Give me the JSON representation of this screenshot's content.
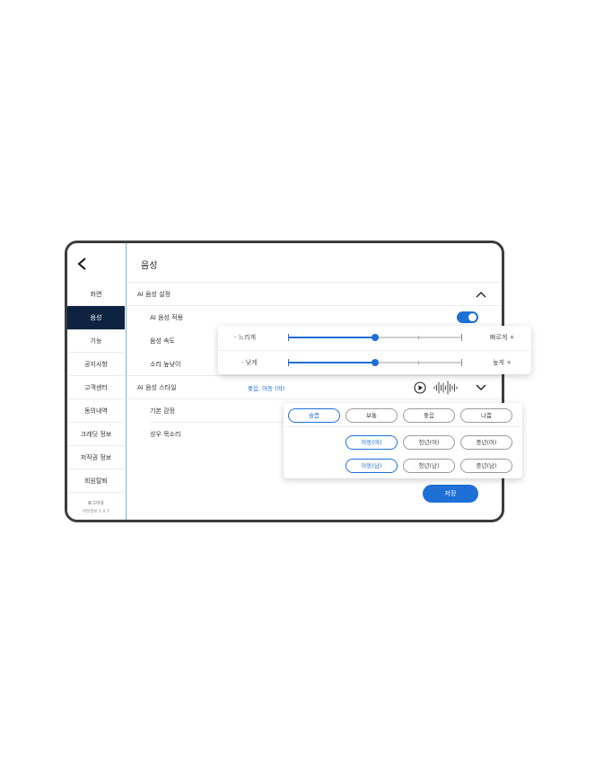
{
  "nav": {
    "items": [
      {
        "label": "화면"
      },
      {
        "label": "음성"
      },
      {
        "label": "기능"
      },
      {
        "label": "공지사항"
      },
      {
        "label": "고객센터"
      },
      {
        "label": "동의내역"
      },
      {
        "label": "크레딧 정보"
      },
      {
        "label": "저작권 정보"
      },
      {
        "label": "회원탈퇴"
      }
    ],
    "active_index": 1,
    "logout_label": "로그아웃",
    "version": "버전정보 1.0.7"
  },
  "page": {
    "title": "음성"
  },
  "settings": {
    "ai_voice_settings_label": "AI 음성 설정",
    "ai_voice_apply_label": "AI 음성 적용",
    "ai_voice_apply_on": true,
    "speed_label": "음성 속도",
    "pitch_label": "소리 높낮이",
    "style_label": "AI 음성 스타일",
    "style_value": "좋음, 아동 (여)",
    "emotion_label": "기본 감정",
    "actor_label": "성우 목소리"
  },
  "sliders": {
    "speed": {
      "left": "- 느리게",
      "right": "빠르게 +",
      "value": 0.5
    },
    "pitch": {
      "left": "- 낮게",
      "right": "높게 +",
      "value": 0.5
    }
  },
  "emotions": [
    {
      "label": "슬픔",
      "selected": true
    },
    {
      "label": "보통",
      "selected": false
    },
    {
      "label": "좋음",
      "selected": false
    },
    {
      "label": "나쁨",
      "selected": false
    }
  ],
  "voices_female": [
    {
      "label": "아동(여)",
      "selected": true
    },
    {
      "label": "청년(여)",
      "selected": false
    },
    {
      "label": "중년(여)",
      "selected": false
    }
  ],
  "voices_male": [
    {
      "label": "아동(남)",
      "selected": true
    },
    {
      "label": "청년(남)",
      "selected": false
    },
    {
      "label": "중년(남)",
      "selected": false
    }
  ],
  "save_label": "저장",
  "colors": {
    "accent": "#1e6fd6",
    "nav_active": "#0d2341",
    "frame": "#3c3c3c"
  }
}
